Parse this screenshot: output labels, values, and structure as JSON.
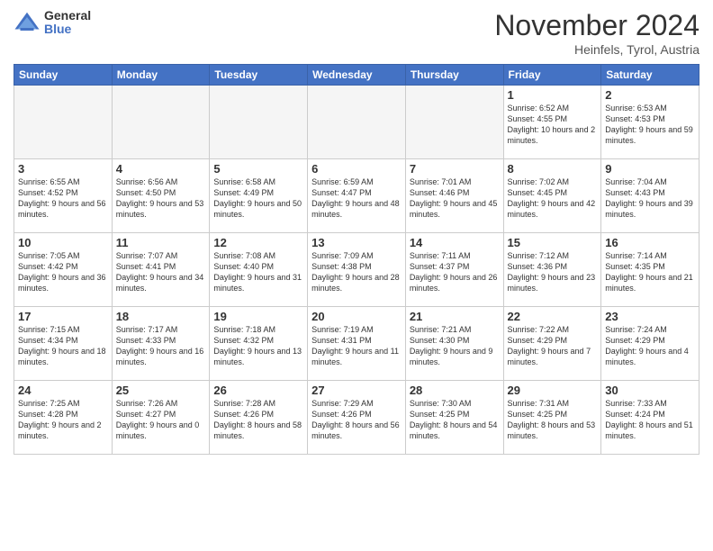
{
  "logo": {
    "general": "General",
    "blue": "Blue"
  },
  "header": {
    "month": "November 2024",
    "location": "Heinfels, Tyrol, Austria"
  },
  "weekdays": [
    "Sunday",
    "Monday",
    "Tuesday",
    "Wednesday",
    "Thursday",
    "Friday",
    "Saturday"
  ],
  "weeks": [
    [
      {
        "day": "",
        "info": ""
      },
      {
        "day": "",
        "info": ""
      },
      {
        "day": "",
        "info": ""
      },
      {
        "day": "",
        "info": ""
      },
      {
        "day": "",
        "info": ""
      },
      {
        "day": "1",
        "info": "Sunrise: 6:52 AM\nSunset: 4:55 PM\nDaylight: 10 hours and 2 minutes."
      },
      {
        "day": "2",
        "info": "Sunrise: 6:53 AM\nSunset: 4:53 PM\nDaylight: 9 hours and 59 minutes."
      }
    ],
    [
      {
        "day": "3",
        "info": "Sunrise: 6:55 AM\nSunset: 4:52 PM\nDaylight: 9 hours and 56 minutes."
      },
      {
        "day": "4",
        "info": "Sunrise: 6:56 AM\nSunset: 4:50 PM\nDaylight: 9 hours and 53 minutes."
      },
      {
        "day": "5",
        "info": "Sunrise: 6:58 AM\nSunset: 4:49 PM\nDaylight: 9 hours and 50 minutes."
      },
      {
        "day": "6",
        "info": "Sunrise: 6:59 AM\nSunset: 4:47 PM\nDaylight: 9 hours and 48 minutes."
      },
      {
        "day": "7",
        "info": "Sunrise: 7:01 AM\nSunset: 4:46 PM\nDaylight: 9 hours and 45 minutes."
      },
      {
        "day": "8",
        "info": "Sunrise: 7:02 AM\nSunset: 4:45 PM\nDaylight: 9 hours and 42 minutes."
      },
      {
        "day": "9",
        "info": "Sunrise: 7:04 AM\nSunset: 4:43 PM\nDaylight: 9 hours and 39 minutes."
      }
    ],
    [
      {
        "day": "10",
        "info": "Sunrise: 7:05 AM\nSunset: 4:42 PM\nDaylight: 9 hours and 36 minutes."
      },
      {
        "day": "11",
        "info": "Sunrise: 7:07 AM\nSunset: 4:41 PM\nDaylight: 9 hours and 34 minutes."
      },
      {
        "day": "12",
        "info": "Sunrise: 7:08 AM\nSunset: 4:40 PM\nDaylight: 9 hours and 31 minutes."
      },
      {
        "day": "13",
        "info": "Sunrise: 7:09 AM\nSunset: 4:38 PM\nDaylight: 9 hours and 28 minutes."
      },
      {
        "day": "14",
        "info": "Sunrise: 7:11 AM\nSunset: 4:37 PM\nDaylight: 9 hours and 26 minutes."
      },
      {
        "day": "15",
        "info": "Sunrise: 7:12 AM\nSunset: 4:36 PM\nDaylight: 9 hours and 23 minutes."
      },
      {
        "day": "16",
        "info": "Sunrise: 7:14 AM\nSunset: 4:35 PM\nDaylight: 9 hours and 21 minutes."
      }
    ],
    [
      {
        "day": "17",
        "info": "Sunrise: 7:15 AM\nSunset: 4:34 PM\nDaylight: 9 hours and 18 minutes."
      },
      {
        "day": "18",
        "info": "Sunrise: 7:17 AM\nSunset: 4:33 PM\nDaylight: 9 hours and 16 minutes."
      },
      {
        "day": "19",
        "info": "Sunrise: 7:18 AM\nSunset: 4:32 PM\nDaylight: 9 hours and 13 minutes."
      },
      {
        "day": "20",
        "info": "Sunrise: 7:19 AM\nSunset: 4:31 PM\nDaylight: 9 hours and 11 minutes."
      },
      {
        "day": "21",
        "info": "Sunrise: 7:21 AM\nSunset: 4:30 PM\nDaylight: 9 hours and 9 minutes."
      },
      {
        "day": "22",
        "info": "Sunrise: 7:22 AM\nSunset: 4:29 PM\nDaylight: 9 hours and 7 minutes."
      },
      {
        "day": "23",
        "info": "Sunrise: 7:24 AM\nSunset: 4:29 PM\nDaylight: 9 hours and 4 minutes."
      }
    ],
    [
      {
        "day": "24",
        "info": "Sunrise: 7:25 AM\nSunset: 4:28 PM\nDaylight: 9 hours and 2 minutes."
      },
      {
        "day": "25",
        "info": "Sunrise: 7:26 AM\nSunset: 4:27 PM\nDaylight: 9 hours and 0 minutes."
      },
      {
        "day": "26",
        "info": "Sunrise: 7:28 AM\nSunset: 4:26 PM\nDaylight: 8 hours and 58 minutes."
      },
      {
        "day": "27",
        "info": "Sunrise: 7:29 AM\nSunset: 4:26 PM\nDaylight: 8 hours and 56 minutes."
      },
      {
        "day": "28",
        "info": "Sunrise: 7:30 AM\nSunset: 4:25 PM\nDaylight: 8 hours and 54 minutes."
      },
      {
        "day": "29",
        "info": "Sunrise: 7:31 AM\nSunset: 4:25 PM\nDaylight: 8 hours and 53 minutes."
      },
      {
        "day": "30",
        "info": "Sunrise: 7:33 AM\nSunset: 4:24 PM\nDaylight: 8 hours and 51 minutes."
      }
    ]
  ]
}
